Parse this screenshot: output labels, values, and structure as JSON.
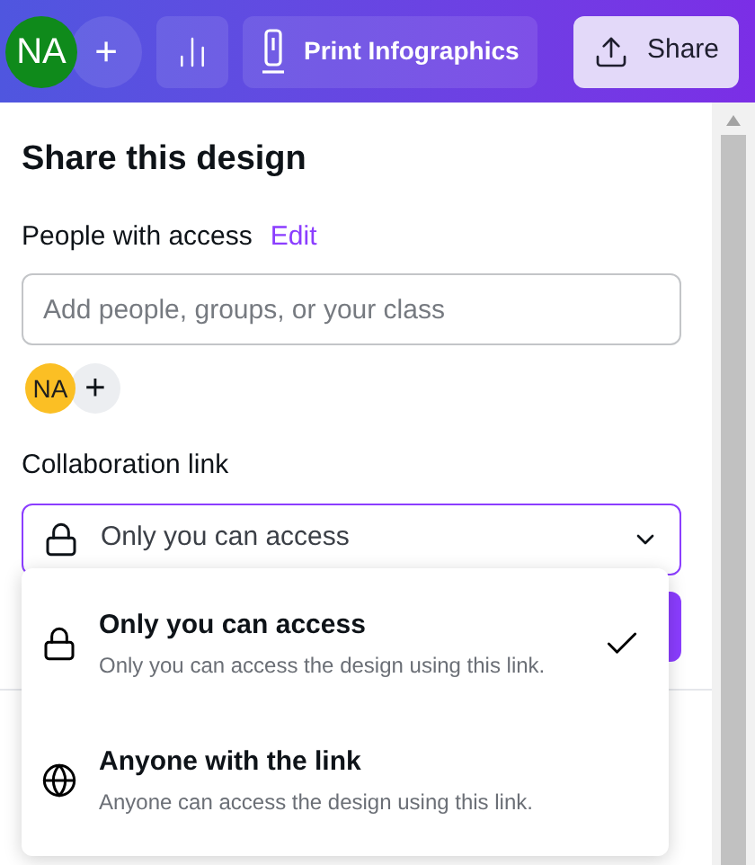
{
  "topbar": {
    "avatar": "NA",
    "add": "+",
    "title_button": "Print Infographics",
    "share_button": "Share"
  },
  "panel": {
    "title": "Share this design",
    "people_label": "People with access",
    "edit_link": "Edit",
    "people_field": {
      "placeholder": "Add people, groups, or your class"
    },
    "member_avatar": "NA",
    "add_member": "+",
    "link_label": "Collaboration link",
    "link_select": {
      "value": "Only you can access",
      "expanded": true
    }
  },
  "options": [
    {
      "kind": "lock",
      "title": "Only you can access",
      "description": "Only you can access the design using this link.",
      "selected": true
    },
    {
      "kind": "globe",
      "title": "Anyone with the link",
      "description": "Anyone can access the design using this link.",
      "selected": false
    }
  ]
}
